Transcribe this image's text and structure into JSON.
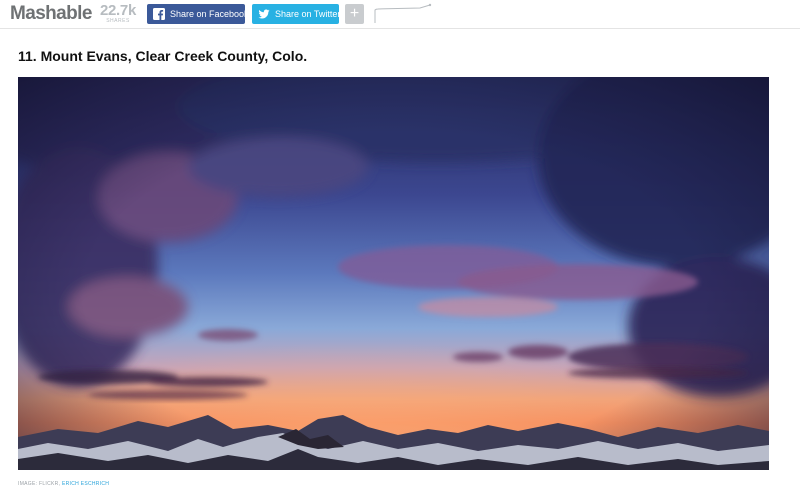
{
  "header": {
    "logo": "Mashable",
    "share_count": "22.7k",
    "share_label": "shares",
    "facebook_label": "Share on Facebook",
    "twitter_label": "Share on Twitter",
    "more_label": "+"
  },
  "article": {
    "heading": "11. Mount Evans, Clear Creek County, Colo.",
    "image_credit_prefix": "Image: Flickr, ",
    "image_credit_name": "Erich Eschrich"
  },
  "colors": {
    "facebook": "#3b5999",
    "twitter": "#28b1e3",
    "logo": "#6f7274"
  },
  "icons": {
    "facebook": "facebook-icon",
    "twitter": "twitter-icon",
    "more": "plus-icon"
  }
}
